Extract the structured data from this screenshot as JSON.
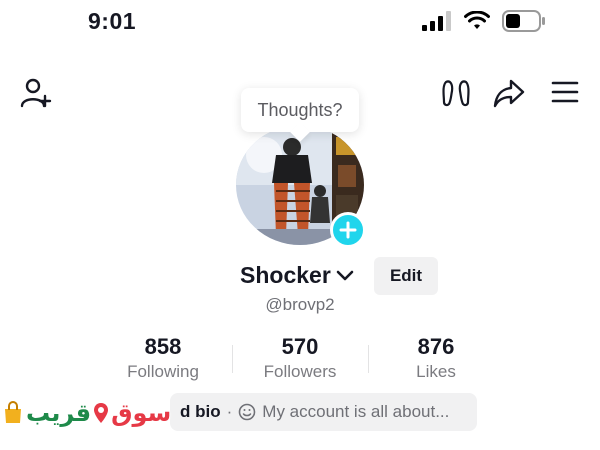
{
  "status_bar": {
    "time": "9:01"
  },
  "top_bar": {
    "icons": [
      "add-friend-icon",
      "footprints-icon",
      "share-icon",
      "menu-icon"
    ]
  },
  "thoughts_bubble": {
    "text": "Thoughts?"
  },
  "profile": {
    "display_name": "Shocker",
    "handle": "@brovp2",
    "edit_label": "Edit"
  },
  "stats": [
    {
      "value": "858",
      "label": "Following"
    },
    {
      "value": "570",
      "label": "Followers"
    },
    {
      "value": "876",
      "label": "Likes"
    }
  ],
  "bio": {
    "add_label": "d bio",
    "separator": "·",
    "placeholder": "My account is all about..."
  },
  "watermark": {
    "text_red": "سوق",
    "text_green": "قريب"
  },
  "colors": {
    "accent_cyan": "#20d5ec",
    "text_primary": "#161823",
    "text_secondary": "#6f7076",
    "chip_bg": "#f1f1f2"
  }
}
